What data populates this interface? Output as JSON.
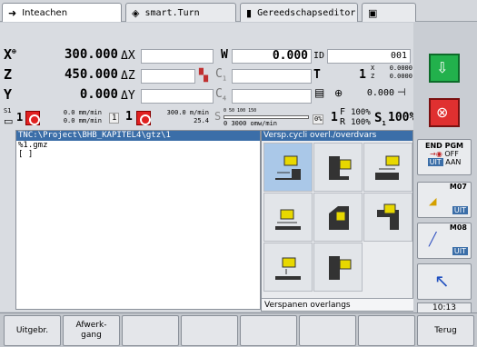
{
  "tabs": [
    {
      "label": "Inteachen",
      "icon": "arrow-right-icon"
    },
    {
      "label": "smart.Turn",
      "icon": "diamond-arrow-icon"
    },
    {
      "label": "Gereedschapseditor",
      "icon": "tool-icon"
    },
    {
      "label": "",
      "icon": "save-icon"
    }
  ],
  "position": {
    "x_label": "X",
    "x_sup": "⊕",
    "x_value": "300.000",
    "dx_label": "ΔX",
    "z_label": "Z",
    "z_value": "450.000",
    "dz_label": "ΔZ",
    "y_label": "Y",
    "y_value": "0.000",
    "dy_label": "ΔY",
    "w_label": "W",
    "w_value": "0.000",
    "id_label": "ID",
    "id_value": "001",
    "t_label": "T",
    "t_value": "1",
    "t_x": "0.0000",
    "t_z": "0.0000",
    "t_x_label": "X",
    "t_z_label": "Z",
    "c1_label": "C",
    "c1_sub": "1",
    "c4_label": "C",
    "c4_sub": "4",
    "spindle_value": "0.000"
  },
  "status": {
    "s1_top": "S1",
    "s1_num": "1",
    "feed1_a": "0.0 mm/min",
    "feed1_b": "0.0 mm/min",
    "spindle2_num": "1",
    "spindle2_id": "1",
    "feed2_a": "300.0 m/min",
    "feed2_b": "25.4",
    "scale_ticks": "0   50  100  150",
    "range_label": "0",
    "rpm_range": "3000 omw/min",
    "pct_label": "0%",
    "f_label": "F",
    "f_value": "100%",
    "r_label": "R",
    "r_value": "100%",
    "s_label": "S",
    "s_sub": "1",
    "s_value": "100%",
    "f_num": "1"
  },
  "file": {
    "path": "TNC:\\Project\\BHB_KAPITEL4\\gtz\\1",
    "lines": [
      "%1.gmz",
      "[ ]"
    ]
  },
  "cycles": {
    "title": "Versp.cycli overl./overdvars",
    "footer": "Verspanen overlangs",
    "items": [
      {
        "icon": "longitudinal-roughing-icon",
        "selected": true
      },
      {
        "icon": "longitudinal-plunge-icon",
        "selected": false
      },
      {
        "icon": "longitudinal-extended-icon",
        "selected": false
      },
      {
        "icon": "transverse-roughing-icon",
        "selected": false
      },
      {
        "icon": "transverse-plunge-icon",
        "selected": false
      },
      {
        "icon": "transverse-extended-icon",
        "selected": false
      },
      {
        "icon": "contour-parallel-icon",
        "selected": false
      },
      {
        "icon": "contour-parallel-plunge-icon",
        "selected": false
      }
    ]
  },
  "sidebar": {
    "end_pgm": "END PGM",
    "off": "OFF",
    "uit": "UIT",
    "aan": "AAN",
    "m07": "M07",
    "m07_state": "UIT",
    "m08": "M08",
    "m08_state": "UIT",
    "time": "10:13"
  },
  "softkeys": [
    {
      "label": "Uitgebr."
    },
    {
      "label": "Afwerk-\ngang"
    },
    {
      "label": ""
    },
    {
      "label": ""
    },
    {
      "label": ""
    },
    {
      "label": ""
    },
    {
      "label": ""
    },
    {
      "label": "Terug"
    }
  ],
  "colors": {
    "accent": "#3b6ea8",
    "start_green": "#22b14c",
    "stop_red": "#e03030",
    "selected_cell": "#aac8e8"
  }
}
